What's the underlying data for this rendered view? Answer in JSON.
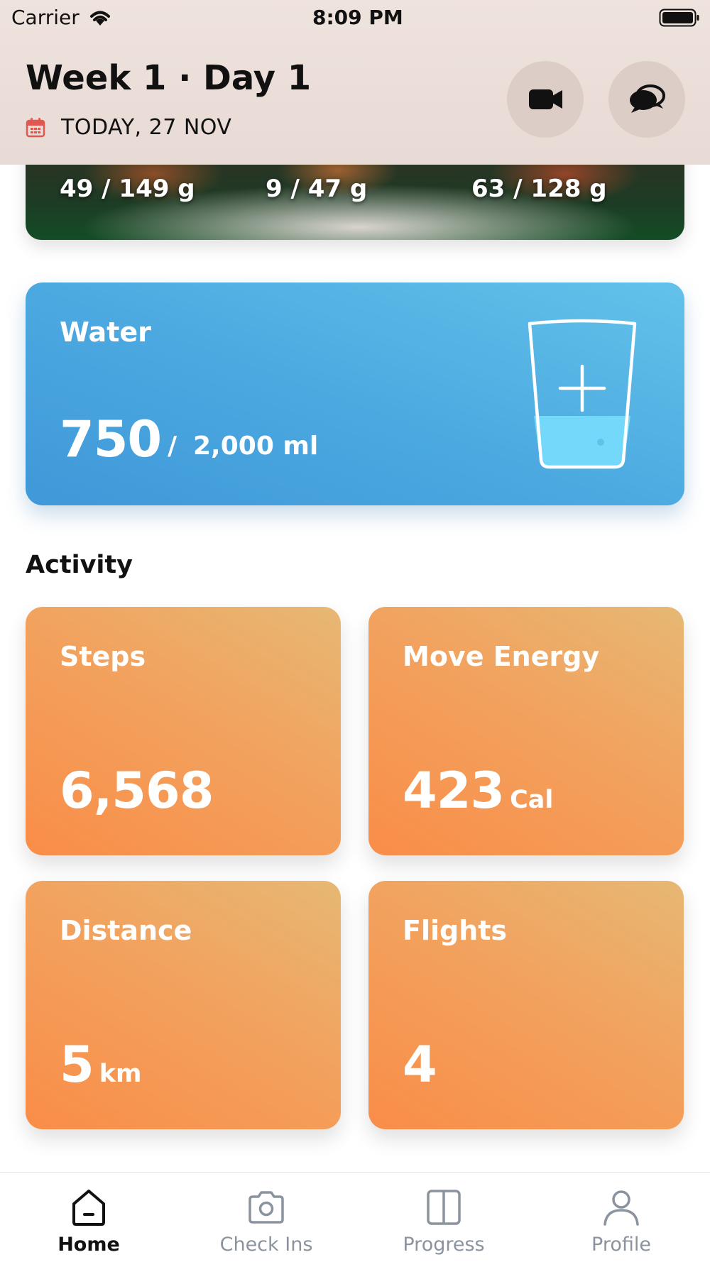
{
  "status_bar": {
    "carrier": "Carrier",
    "time": "8:09 PM"
  },
  "header": {
    "title": "Week 1 · Day 1",
    "date": "TODAY, 27 NOV",
    "icons": [
      "calendar-icon",
      "video-camera-icon",
      "chat-bubbles-icon"
    ]
  },
  "macros": [
    {
      "value": "49 / 149 g"
    },
    {
      "value": "9 / 47 g"
    },
    {
      "value": "63 / 128 g"
    }
  ],
  "water": {
    "title": "Water",
    "value": "750",
    "separator": "/",
    "goal": "2,000 ml",
    "progress": 0.375,
    "icon": "water-glass-add-icon"
  },
  "activity": {
    "title": "Activity",
    "tiles": [
      {
        "label": "Steps",
        "value": "6,568",
        "unit": ""
      },
      {
        "label": "Move Energy",
        "value": "423",
        "unit": "Cal"
      },
      {
        "label": "Distance",
        "value": "5",
        "unit": "km"
      },
      {
        "label": "Flights",
        "value": "4",
        "unit": ""
      }
    ]
  },
  "tabbar": {
    "items": [
      {
        "label": "Home",
        "icon": "home-icon",
        "active": true
      },
      {
        "label": "Check Ins",
        "icon": "camera-icon",
        "active": false
      },
      {
        "label": "Progress",
        "icon": "split-panel-icon",
        "active": false
      },
      {
        "label": "Profile",
        "icon": "person-icon",
        "active": false
      }
    ]
  },
  "colors": {
    "water_gradient": [
      "#63c2ea",
      "#3f98d8"
    ],
    "activity_gradient": [
      "#f98d48",
      "#e6b874"
    ],
    "header_bg": "#efe3dd",
    "calendar_icon": "#e0584f",
    "tab_active": "#111111",
    "tab_inactive": "#8a939e"
  }
}
